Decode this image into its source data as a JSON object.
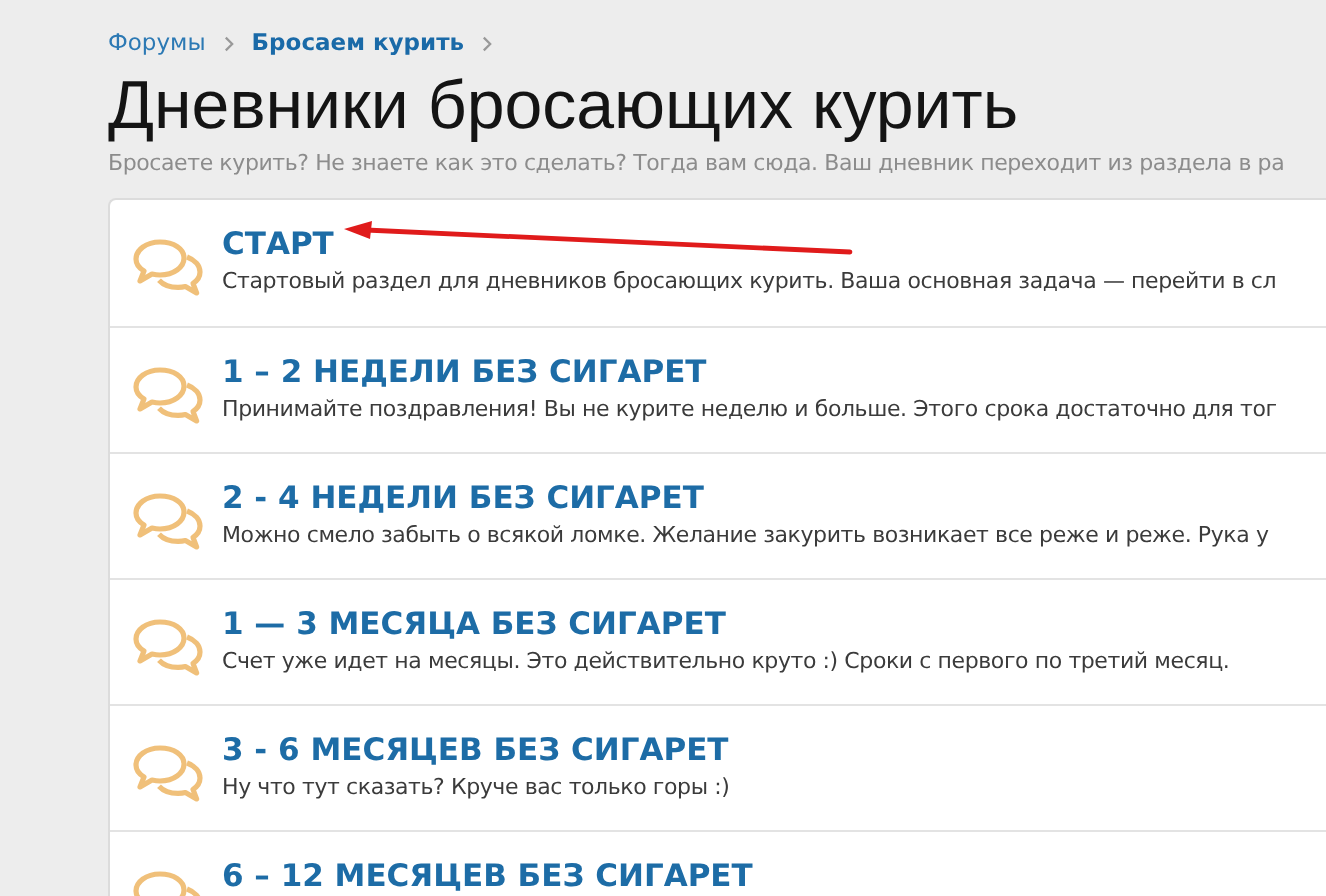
{
  "breadcrumbs": [
    {
      "label": "Форумы",
      "current": false
    },
    {
      "label": "Бросаем курить",
      "current": true
    }
  ],
  "title": "Дневники бросающих курить",
  "description": "Бросаете курить? Не знаете как это сделать? Тогда вам сюда. Ваш дневник переходит из раздела в ра",
  "forums": [
    {
      "title": "СТАРТ",
      "description": "Стартовый раздел для дневников бросающих курить. Ваша основная задача — перейти в сл",
      "annotated": true
    },
    {
      "title": "1 – 2 НЕДЕЛИ БЕЗ СИГАРЕТ",
      "description": "Принимайте поздравления! Вы не курите неделю и больше. Этого срока достаточно для тог",
      "annotated": false
    },
    {
      "title": "2 - 4 НЕДЕЛИ БЕЗ СИГАРЕТ",
      "description": "Можно смело забыть о всякой ломке. Желание закурить возникает все реже и реже. Рука у",
      "annotated": false
    },
    {
      "title": "1 — 3 МЕСЯЦА БЕЗ СИГАРЕТ",
      "description": "Счет уже идет на месяцы. Это действительно круто :) Сроки с первого по третий месяц.",
      "annotated": false
    },
    {
      "title": "3 - 6 МЕСЯЦЕВ БЕЗ СИГАРЕТ",
      "description": "Ну что тут сказать? Круче вас только горы :)",
      "annotated": false
    },
    {
      "title": "6 – 12 МЕСЯЦЕВ БЕЗ СИГАРЕТ",
      "annotated": false
    }
  ]
}
